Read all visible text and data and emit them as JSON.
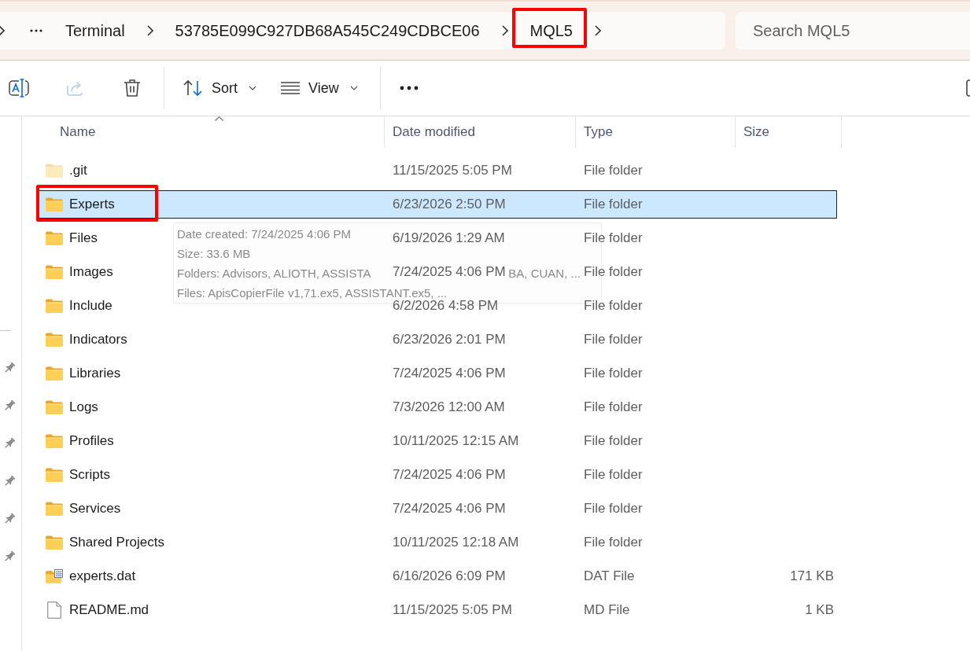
{
  "address_bar": {
    "segments": [
      {
        "label": "Terminal",
        "highlighted": false
      },
      {
        "label": "53785E099C927DB68A545C249CDBCE06",
        "highlighted": false
      },
      {
        "label": "MQL5",
        "highlighted": true
      }
    ]
  },
  "search": {
    "placeholder": "Search MQL5"
  },
  "toolbar": {
    "items": [
      {
        "kind": "rename",
        "disabled": false
      },
      {
        "kind": "share",
        "disabled": true
      },
      {
        "kind": "delete",
        "disabled": false
      },
      {
        "kind": "separator"
      },
      {
        "kind": "sort",
        "label": "Sort",
        "disabled": false
      },
      {
        "kind": "view",
        "label": "View",
        "disabled": false
      },
      {
        "kind": "separator"
      },
      {
        "kind": "more",
        "disabled": false
      }
    ]
  },
  "nav_pane": {
    "items": [
      {
        "pinned": true
      },
      {
        "pinned": true
      },
      {
        "pinned": true
      },
      {
        "pinned": true
      },
      {
        "pinned": true
      },
      {
        "pinned": true
      }
    ]
  },
  "columns": [
    {
      "label": "Name",
      "sorted": true
    },
    {
      "label": "Date modified",
      "sorted": false
    },
    {
      "label": "Type",
      "sorted": false
    },
    {
      "label": "Size",
      "sorted": false
    }
  ],
  "rows": [
    {
      "kind": "folder",
      "name": ".git",
      "date_modified": "11/15/2025 5:05 PM",
      "type": "File folder",
      "hidden": true,
      "selected": false,
      "highlighted": false
    },
    {
      "kind": "folder",
      "name": "Experts",
      "date_modified": "6/23/2026 2:50 PM",
      "type": "File folder",
      "hidden": false,
      "selected": true,
      "highlighted": true
    },
    {
      "kind": "folder",
      "name": "Files",
      "date_modified": "6/19/2026 1:29 AM",
      "type": "File folder",
      "hidden": false,
      "selected": false,
      "highlighted": false
    },
    {
      "kind": "folder",
      "name": "Images",
      "date_modified": "7/24/2025 4:06 PM",
      "type": "File folder",
      "hidden": false,
      "selected": false,
      "highlighted": false
    },
    {
      "kind": "folder",
      "name": "Include",
      "date_modified": "6/2/2026 4:58 PM",
      "type": "File folder",
      "hidden": false,
      "selected": false,
      "highlighted": false
    },
    {
      "kind": "folder",
      "name": "Indicators",
      "date_modified": "6/23/2026 2:01 PM",
      "type": "File folder",
      "hidden": false,
      "selected": false,
      "highlighted": false
    },
    {
      "kind": "folder",
      "name": "Libraries",
      "date_modified": "7/24/2025 4:06 PM",
      "type": "File folder",
      "hidden": false,
      "selected": false,
      "highlighted": false
    },
    {
      "kind": "folder",
      "name": "Logs",
      "date_modified": "7/3/2026 12:00 AM",
      "type": "File folder",
      "hidden": false,
      "selected": false,
      "highlighted": false
    },
    {
      "kind": "folder",
      "name": "Profiles",
      "date_modified": "10/11/2025 12:15 AM",
      "type": "File folder",
      "hidden": false,
      "selected": false,
      "highlighted": false
    },
    {
      "kind": "folder",
      "name": "Scripts",
      "date_modified": "7/24/2025 4:06 PM",
      "type": "File folder",
      "hidden": false,
      "selected": false,
      "highlighted": false
    },
    {
      "kind": "folder",
      "name": "Services",
      "date_modified": "7/24/2025 4:06 PM",
      "type": "File folder",
      "hidden": false,
      "selected": false,
      "highlighted": false
    },
    {
      "kind": "folder",
      "name": "Shared Projects",
      "date_modified": "10/11/2025 12:18 AM",
      "type": "File folder",
      "hidden": false,
      "selected": false,
      "highlighted": false
    },
    {
      "kind": "data",
      "name": "experts.dat",
      "date_modified": "6/16/2026 6:09 PM",
      "type": "DAT File",
      "size": "171 KB",
      "hidden": false,
      "selected": false,
      "highlighted": false
    },
    {
      "kind": "text",
      "name": "README.md",
      "date_modified": "11/15/2025 5:05 PM",
      "type": "MD File",
      "size": "1 KB",
      "hidden": false,
      "selected": false,
      "highlighted": false
    }
  ],
  "tooltip": {
    "lines": [
      [
        "Date created: 7/24/2025 4:06 PM"
      ],
      [
        "Size: 33.6 MB"
      ],
      [
        "Folders: Advisors, ALIOTH, ASSISTA",
        "BA, CUAN, ..."
      ],
      [
        "Files: ApisCopierFile v1,71.ex5, ASSISTANT.ex5, ..."
      ]
    ]
  }
}
